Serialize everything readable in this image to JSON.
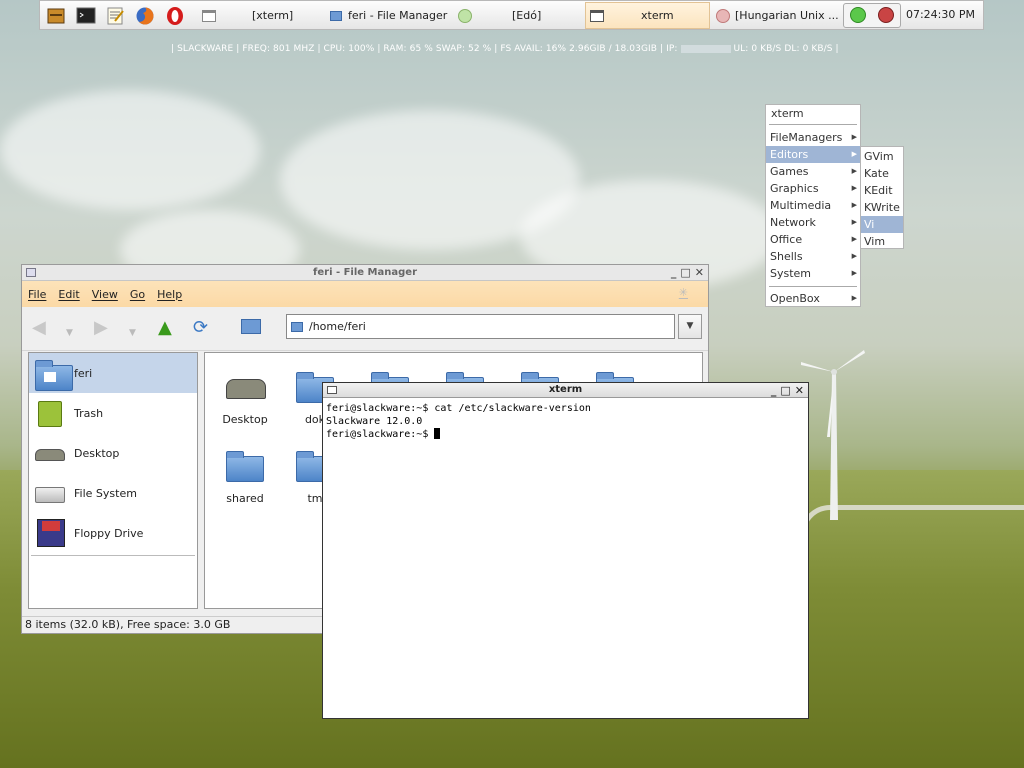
{
  "panel": {
    "launchers": [
      "file-manager-icon",
      "terminal-icon",
      "text-editor-icon",
      "firefox-icon",
      "opera-icon"
    ],
    "tasks": [
      {
        "label": "[xterm]",
        "active": false
      },
      {
        "label": "feri - File Manager",
        "active": false
      },
      {
        "label": "[Edó]",
        "active": false
      },
      {
        "label": "xterm",
        "active": true
      },
      {
        "label": "[Hungarian Unix ...",
        "active": false
      }
    ],
    "clock": "07:24:30 PM"
  },
  "conky": {
    "pre_ip": "| SLACKWARE | FREQ: 801  MHZ | CPU: 100% | RAM: 65 % SWAP: 52 % | FS AVAIL: 16% 2.96GIB / 18.03GIB | IP:",
    "post_ip": "UL: 0   KB/S DL: 0    KB/S |"
  },
  "file_manager": {
    "title": "feri - File Manager",
    "menu": [
      "File",
      "Edit",
      "View",
      "Go",
      "Help"
    ],
    "location": "/home/feri",
    "sidebar": [
      {
        "label": "feri",
        "icon": "home-folder-icon",
        "selected": true
      },
      {
        "label": "Trash",
        "icon": "trash-icon",
        "selected": false
      },
      {
        "label": "Desktop",
        "icon": "desktop-icon",
        "selected": false
      },
      {
        "label": "File System",
        "icon": "harddisk-icon",
        "selected": false
      },
      {
        "label": "Floppy Drive",
        "icon": "floppy-icon",
        "selected": false
      }
    ],
    "files": [
      {
        "label": "Desktop",
        "icon": "desktop-icon"
      },
      {
        "label": "dok",
        "icon": "folder-icon"
      },
      {
        "label": "",
        "icon": "folder-icon"
      },
      {
        "label": "",
        "icon": "folder-icon"
      },
      {
        "label": "",
        "icon": "folder-icon"
      },
      {
        "label": "",
        "icon": "folder-icon"
      },
      {
        "label": "shared",
        "icon": "folder-icon"
      },
      {
        "label": "tm",
        "icon": "folder-icon"
      }
    ],
    "status": "8 items (32.0 kB), Free space: 3.0 GB"
  },
  "xterm": {
    "title": "xterm",
    "lines": [
      "feri@slackware:~$ cat /etc/slackware-version",
      "Slackware 12.0.0",
      "feri@slackware:~$ "
    ]
  },
  "menu": {
    "title": "xterm",
    "items": [
      {
        "label": "FileManagers",
        "submenu": true,
        "selected": false
      },
      {
        "label": "Editors",
        "submenu": true,
        "selected": true
      },
      {
        "label": "Games",
        "submenu": true,
        "selected": false
      },
      {
        "label": "Graphics",
        "submenu": true,
        "selected": false
      },
      {
        "label": "Multimedia",
        "submenu": true,
        "selected": false
      },
      {
        "label": "Network",
        "submenu": true,
        "selected": false
      },
      {
        "label": "Office",
        "submenu": true,
        "selected": false
      },
      {
        "label": "Shells",
        "submenu": true,
        "selected": false
      },
      {
        "label": "System",
        "submenu": true,
        "selected": false
      }
    ],
    "footer": {
      "label": "OpenBox",
      "submenu": true
    },
    "submenu": [
      {
        "label": "GVim",
        "selected": false
      },
      {
        "label": "Kate",
        "selected": false
      },
      {
        "label": "KEdit",
        "selected": false
      },
      {
        "label": "KWrite",
        "selected": false
      },
      {
        "label": "Vi",
        "selected": true
      },
      {
        "label": "Vim",
        "selected": false
      }
    ]
  },
  "colors": {
    "selection": "#9fb5d5",
    "menubar": "#fbd9a6",
    "task_active": "#fbe4bf"
  }
}
